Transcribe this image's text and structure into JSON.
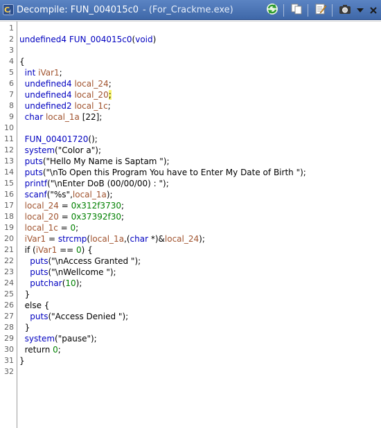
{
  "window": {
    "title": "Decompile: FUN_004015c0",
    "subtitle": "- (For_Crackme.exe)"
  },
  "toolbar": {
    "icons": [
      "refresh-icon",
      "copy-icon",
      "edit-icon",
      "snapshot-icon",
      "menu-arrow-icon",
      "close-icon"
    ]
  },
  "colors": {
    "title_bar": "#4a74b6",
    "type_keyword": "#0000c0",
    "local_variable": "#a0522d",
    "function": "#0000c0",
    "string": "#008000",
    "highlight": "#f7f36a"
  },
  "lines": [
    {
      "n": "1",
      "tokens": []
    },
    {
      "n": "2",
      "tokens": [
        {
          "t": "undefined4 ",
          "c": "kw-type"
        },
        {
          "t": "FUN_004015c0",
          "c": "fn"
        },
        {
          "t": "(",
          "c": "plain"
        },
        {
          "t": "void",
          "c": "kw-type"
        },
        {
          "t": ")",
          "c": "plain"
        }
      ]
    },
    {
      "n": "3",
      "tokens": []
    },
    {
      "n": "4",
      "tokens": [
        {
          "t": "{",
          "c": "plain"
        }
      ]
    },
    {
      "n": "5",
      "tokens": [
        {
          "t": "  ",
          "c": "plain"
        },
        {
          "t": "int ",
          "c": "kw-type"
        },
        {
          "t": "iVar1",
          "c": "var"
        },
        {
          "t": ";",
          "c": "plain"
        }
      ]
    },
    {
      "n": "6",
      "tokens": [
        {
          "t": "  ",
          "c": "plain"
        },
        {
          "t": "undefined4 ",
          "c": "kw-type"
        },
        {
          "t": "local_24",
          "c": "var"
        },
        {
          "t": ";",
          "c": "plain"
        }
      ]
    },
    {
      "n": "7",
      "tokens": [
        {
          "t": "  ",
          "c": "plain"
        },
        {
          "t": "undefined4 ",
          "c": "kw-type"
        },
        {
          "t": "local_20",
          "c": "var"
        },
        {
          "t": ";",
          "c": "highlight-semicolon"
        }
      ]
    },
    {
      "n": "8",
      "tokens": [
        {
          "t": "  ",
          "c": "plain"
        },
        {
          "t": "undefined2 ",
          "c": "kw-type"
        },
        {
          "t": "local_1c",
          "c": "var"
        },
        {
          "t": ";",
          "c": "plain"
        }
      ]
    },
    {
      "n": "9",
      "tokens": [
        {
          "t": "  ",
          "c": "plain"
        },
        {
          "t": "char ",
          "c": "kw-type"
        },
        {
          "t": "local_1a ",
          "c": "var"
        },
        {
          "t": "[22];",
          "c": "plain"
        }
      ]
    },
    {
      "n": "10",
      "tokens": []
    },
    {
      "n": "11",
      "tokens": [
        {
          "t": "  ",
          "c": "plain"
        },
        {
          "t": "FUN_00401720",
          "c": "fn"
        },
        {
          "t": "();",
          "c": "plain"
        }
      ]
    },
    {
      "n": "12",
      "tokens": [
        {
          "t": "  ",
          "c": "plain"
        },
        {
          "t": "system",
          "c": "fn"
        },
        {
          "t": "(",
          "c": "plain"
        },
        {
          "t": "\"Color a\"",
          "c": "plain"
        },
        {
          "t": ");",
          "c": "plain"
        }
      ]
    },
    {
      "n": "13",
      "tokens": [
        {
          "t": "  ",
          "c": "plain"
        },
        {
          "t": "puts",
          "c": "fn"
        },
        {
          "t": "(",
          "c": "plain"
        },
        {
          "t": "\"Hello My Name is Saptam \"",
          "c": "plain"
        },
        {
          "t": ");",
          "c": "plain"
        }
      ]
    },
    {
      "n": "14",
      "tokens": [
        {
          "t": "  ",
          "c": "plain"
        },
        {
          "t": "puts",
          "c": "fn"
        },
        {
          "t": "(",
          "c": "plain"
        },
        {
          "t": "\"\\nTo Open this Program You have to Enter My Date of Birth \"",
          "c": "plain"
        },
        {
          "t": ");",
          "c": "plain"
        }
      ]
    },
    {
      "n": "15",
      "tokens": [
        {
          "t": "  ",
          "c": "plain"
        },
        {
          "t": "printf",
          "c": "fn"
        },
        {
          "t": "(",
          "c": "plain"
        },
        {
          "t": "\"\\nEnter DoB (00/00/00) : \"",
          "c": "plain"
        },
        {
          "t": ");",
          "c": "plain"
        }
      ]
    },
    {
      "n": "16",
      "tokens": [
        {
          "t": "  ",
          "c": "plain"
        },
        {
          "t": "scanf",
          "c": "fn"
        },
        {
          "t": "(",
          "c": "plain"
        },
        {
          "t": "\"%s\"",
          "c": "plain"
        },
        {
          "t": ",",
          "c": "plain"
        },
        {
          "t": "local_1a",
          "c": "var"
        },
        {
          "t": ");",
          "c": "plain"
        }
      ]
    },
    {
      "n": "17",
      "tokens": [
        {
          "t": "  ",
          "c": "plain"
        },
        {
          "t": "local_24",
          "c": "var"
        },
        {
          "t": " = ",
          "c": "plain"
        },
        {
          "t": "0x312f3730",
          "c": "num"
        },
        {
          "t": ";",
          "c": "plain"
        }
      ]
    },
    {
      "n": "18",
      "tokens": [
        {
          "t": "  ",
          "c": "plain"
        },
        {
          "t": "local_20",
          "c": "var"
        },
        {
          "t": " = ",
          "c": "plain"
        },
        {
          "t": "0x37392f30",
          "c": "num"
        },
        {
          "t": ";",
          "c": "plain"
        }
      ]
    },
    {
      "n": "19",
      "tokens": [
        {
          "t": "  ",
          "c": "plain"
        },
        {
          "t": "local_1c",
          "c": "var"
        },
        {
          "t": " = ",
          "c": "plain"
        },
        {
          "t": "0",
          "c": "num"
        },
        {
          "t": ";",
          "c": "plain"
        }
      ]
    },
    {
      "n": "20",
      "tokens": [
        {
          "t": "  ",
          "c": "plain"
        },
        {
          "t": "iVar1",
          "c": "var"
        },
        {
          "t": " = ",
          "c": "plain"
        },
        {
          "t": "strcmp",
          "c": "fn"
        },
        {
          "t": "(",
          "c": "plain"
        },
        {
          "t": "local_1a",
          "c": "var"
        },
        {
          "t": ",(",
          "c": "plain"
        },
        {
          "t": "char",
          "c": "kw-type"
        },
        {
          "t": " *)&",
          "c": "plain"
        },
        {
          "t": "local_24",
          "c": "var"
        },
        {
          "t": ");",
          "c": "plain"
        }
      ]
    },
    {
      "n": "21",
      "tokens": [
        {
          "t": "  ",
          "c": "plain"
        },
        {
          "t": "if",
          "c": "plain"
        },
        {
          "t": " (",
          "c": "plain"
        },
        {
          "t": "iVar1",
          "c": "var"
        },
        {
          "t": " == ",
          "c": "plain"
        },
        {
          "t": "0",
          "c": "num"
        },
        {
          "t": ") {",
          "c": "plain"
        }
      ]
    },
    {
      "n": "22",
      "tokens": [
        {
          "t": "    ",
          "c": "plain"
        },
        {
          "t": "puts",
          "c": "fn"
        },
        {
          "t": "(",
          "c": "plain"
        },
        {
          "t": "\"\\nAccess Granted \"",
          "c": "plain"
        },
        {
          "t": ");",
          "c": "plain"
        }
      ]
    },
    {
      "n": "23",
      "tokens": [
        {
          "t": "    ",
          "c": "plain"
        },
        {
          "t": "puts",
          "c": "fn"
        },
        {
          "t": "(",
          "c": "plain"
        },
        {
          "t": "\"\\nWellcome \"",
          "c": "plain"
        },
        {
          "t": ");",
          "c": "plain"
        }
      ]
    },
    {
      "n": "24",
      "tokens": [
        {
          "t": "    ",
          "c": "plain"
        },
        {
          "t": "putchar",
          "c": "fn"
        },
        {
          "t": "(",
          "c": "plain"
        },
        {
          "t": "10",
          "c": "num"
        },
        {
          "t": ");",
          "c": "plain"
        }
      ]
    },
    {
      "n": "25",
      "tokens": [
        {
          "t": "  }",
          "c": "plain"
        }
      ]
    },
    {
      "n": "26",
      "tokens": [
        {
          "t": "  else {",
          "c": "plain"
        }
      ]
    },
    {
      "n": "27",
      "tokens": [
        {
          "t": "    ",
          "c": "plain"
        },
        {
          "t": "puts",
          "c": "fn"
        },
        {
          "t": "(",
          "c": "plain"
        },
        {
          "t": "\"Access Denied \"",
          "c": "plain"
        },
        {
          "t": ");",
          "c": "plain"
        }
      ]
    },
    {
      "n": "28",
      "tokens": [
        {
          "t": "  }",
          "c": "plain"
        }
      ]
    },
    {
      "n": "29",
      "tokens": [
        {
          "t": "  ",
          "c": "plain"
        },
        {
          "t": "system",
          "c": "fn"
        },
        {
          "t": "(",
          "c": "plain"
        },
        {
          "t": "\"pause\"",
          "c": "plain"
        },
        {
          "t": ");",
          "c": "plain"
        }
      ]
    },
    {
      "n": "30",
      "tokens": [
        {
          "t": "  return ",
          "c": "plain"
        },
        {
          "t": "0",
          "c": "num"
        },
        {
          "t": ";",
          "c": "plain"
        }
      ]
    },
    {
      "n": "31",
      "tokens": [
        {
          "t": "}",
          "c": "plain"
        }
      ]
    },
    {
      "n": "32",
      "tokens": []
    }
  ]
}
